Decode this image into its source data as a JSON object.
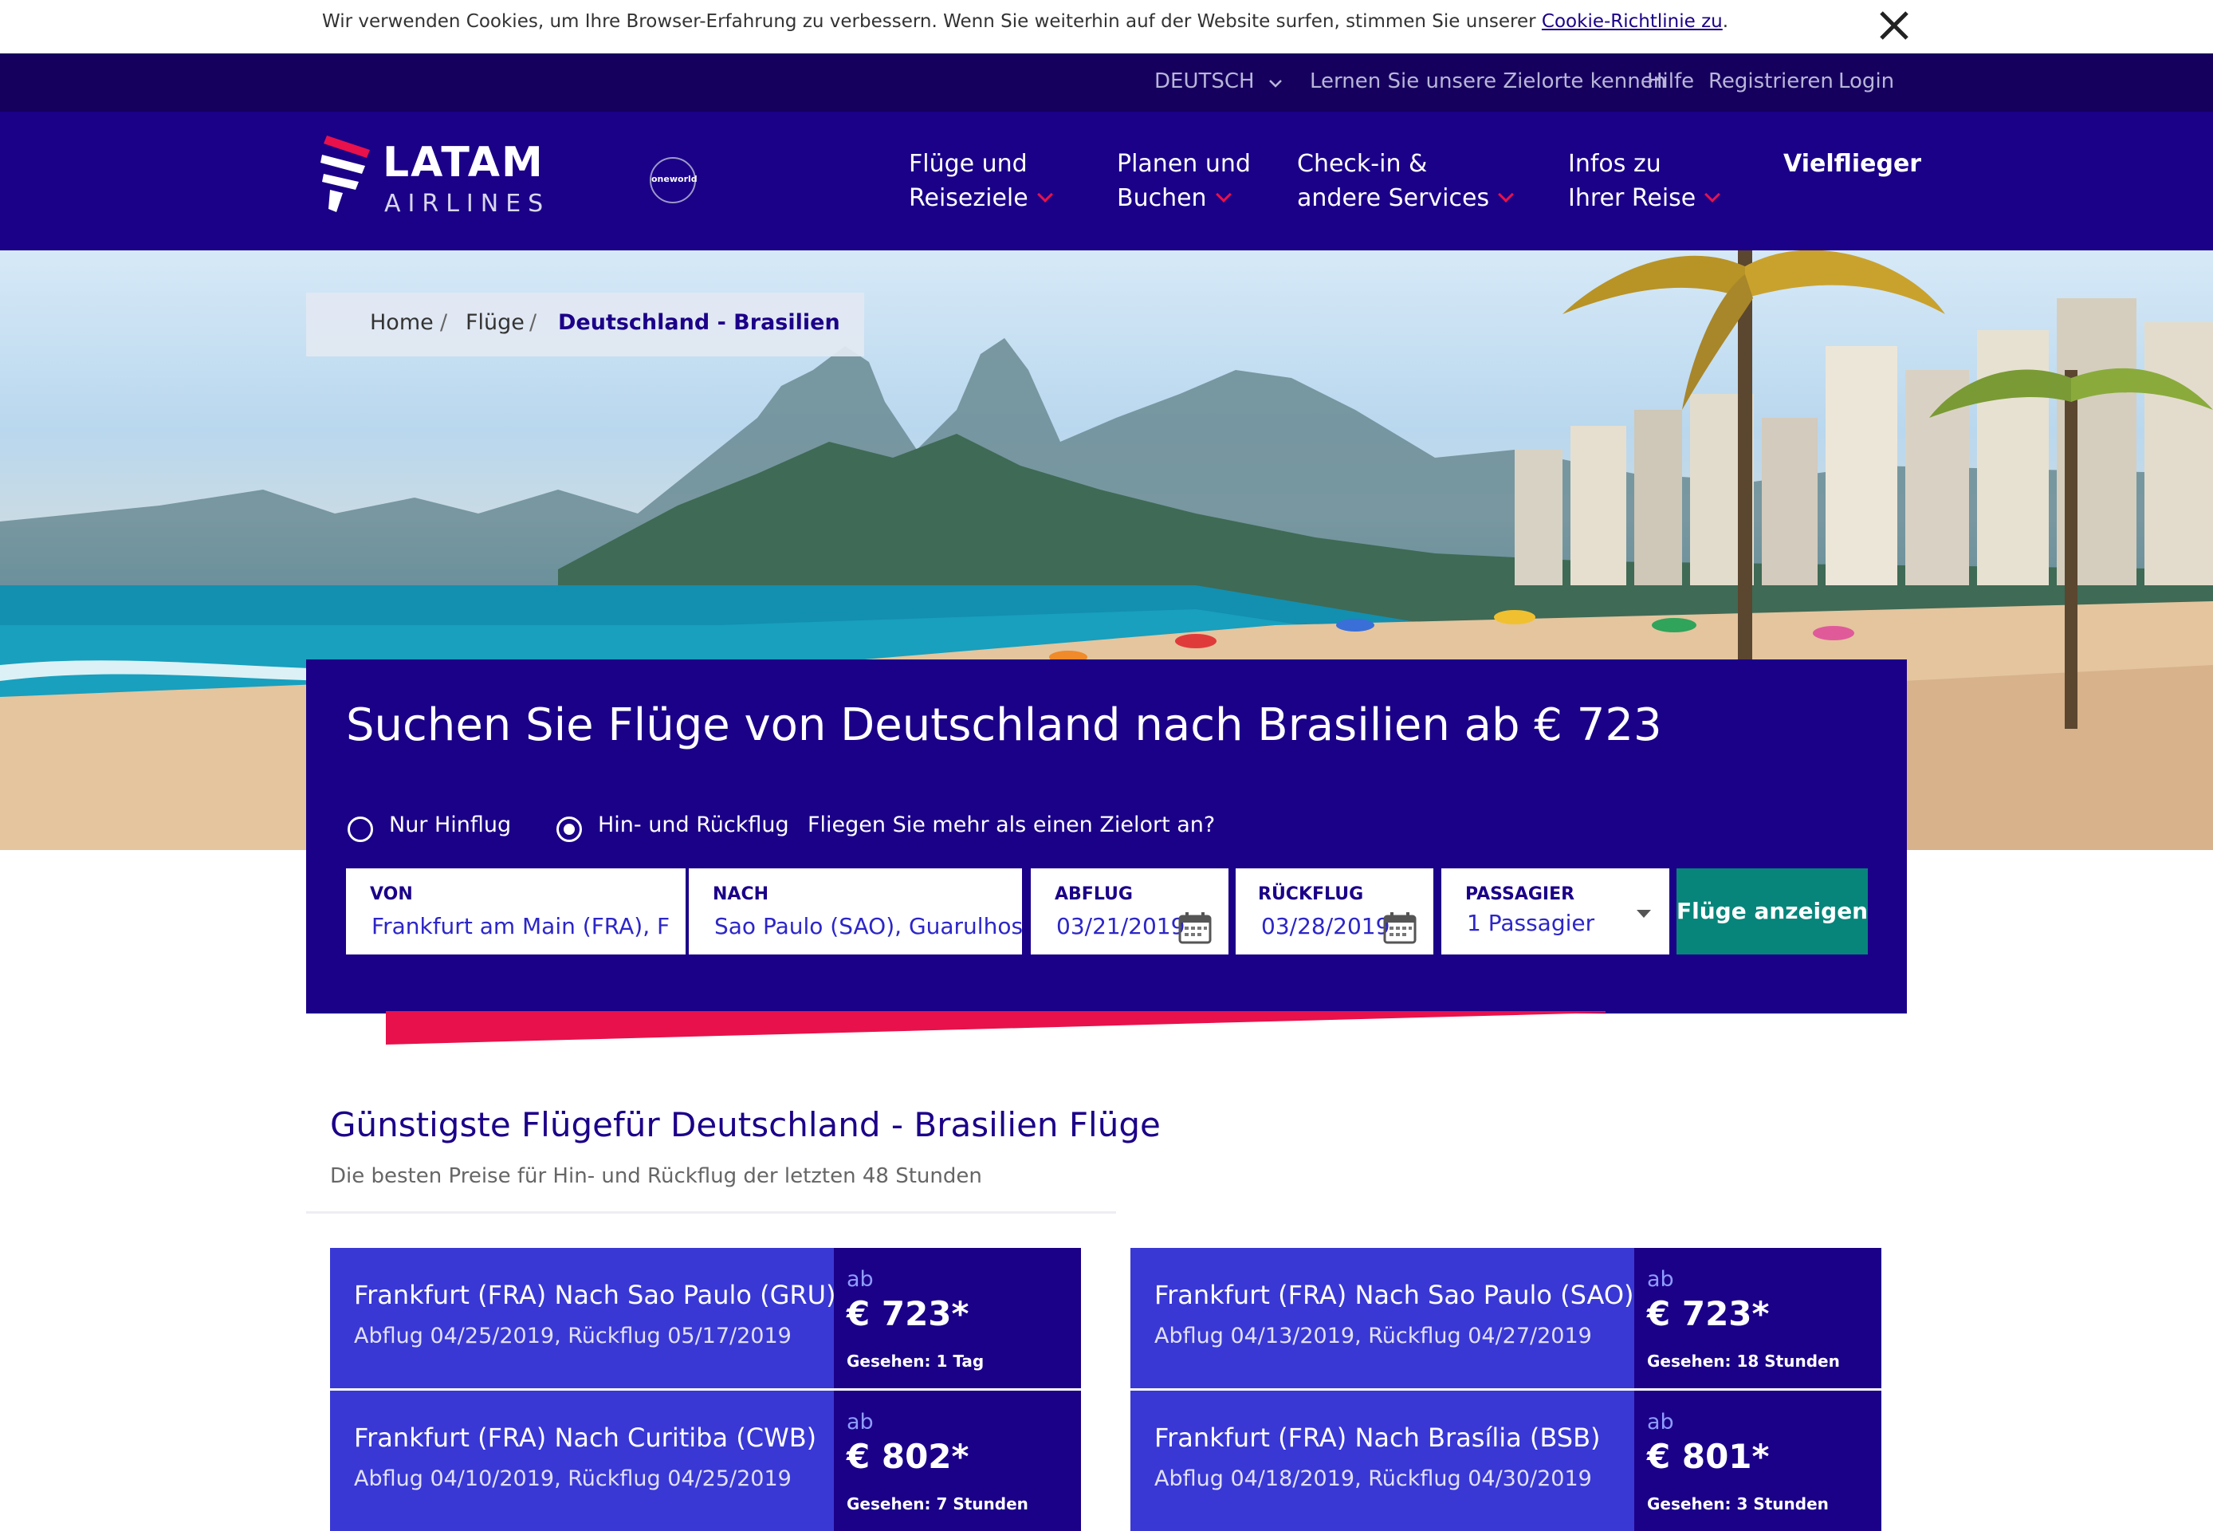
{
  "cookie": {
    "text": "Wir verwenden Cookies, um Ihre Browser-Erfahrung zu verbessern. Wenn Sie weiterhin auf der Website surfen, stimmen Sie unserer ",
    "link": "Cookie-Richtlinie zu",
    "suffix": "."
  },
  "topbar": {
    "language": "DEUTSCH",
    "destinations": "Lernen Sie unsere Zielorte kennen",
    "help": "Hilfe",
    "register": "Registrieren",
    "login": "Login"
  },
  "logo": {
    "line1": "LATAM",
    "line2": "AIRLINES",
    "partner": "oneworld"
  },
  "nav": [
    {
      "l1": "Flüge und",
      "l2": "Reiseziele"
    },
    {
      "l1": "Planen und",
      "l2": "Buchen"
    },
    {
      "l1": "Check-in &",
      "l2": "andere Services"
    },
    {
      "l1": "Infos zu",
      "l2": "Ihrer Reise"
    },
    {
      "l1": "Vielflieger"
    }
  ],
  "breadcrumb": {
    "home": "Home",
    "sep": "/",
    "flights": "Flüge",
    "current": "Deutschland - Brasilien"
  },
  "search": {
    "title": "Suchen Sie Flüge von Deutschland nach Brasilien ab € 723",
    "one_way": "Nur Hinflug",
    "round_trip": "Hin- und Rückflug",
    "multi": "Fliegen Sie mehr als einen Zielort an?",
    "from_label": "VON",
    "from_value": "Frankfurt am Main (FRA), F",
    "to_label": "NACH",
    "to_value": "Sao Paulo (SAO), Guarulhos",
    "depart_label": "ABFLUG",
    "depart_value": "03/21/2019",
    "return_label": "RÜCKFLUG",
    "return_value": "03/28/2019",
    "pax_label": "PASSAGIER",
    "pax_value": "1 Passagier",
    "submit": "Flüge anzeigen"
  },
  "cheapest": {
    "title": "Günstigste Flügefür Deutschland - Brasilien Flüge",
    "subtitle": "Die besten Preise für Hin- und Rückflug der letzten 48 Stunden",
    "cards": [
      {
        "route": "Frankfurt (FRA) Nach Sao Paulo (GRU)",
        "dates": "Abflug 04/25/2019, Rückflug 05/17/2019",
        "ab": "ab",
        "price": "€ 723*",
        "seen": "Gesehen: 1 Tag"
      },
      {
        "route": "Frankfurt (FRA) Nach Sao Paulo (SAO)",
        "dates": "Abflug 04/13/2019, Rückflug 04/27/2019",
        "ab": "ab",
        "price": "€ 723*",
        "seen": "Gesehen: 18 Stunden"
      },
      {
        "route": "Frankfurt (FRA) Nach Curitiba (CWB)",
        "dates": "Abflug 04/10/2019, Rückflug 04/25/2019",
        "ab": "ab",
        "price": "€ 802*",
        "seen": "Gesehen: 7 Stunden"
      },
      {
        "route": "Frankfurt (FRA) Nach Brasília (BSB)",
        "dates": "Abflug 04/18/2019, Rückflug 04/30/2019",
        "ab": "ab",
        "price": "€ 801*",
        "seen": "Gesehen: 3 Stunden"
      }
    ]
  },
  "colors": {
    "brand": "#1b0088",
    "accent": "#e8114b",
    "cta": "#07857b",
    "card": "#3938d4"
  }
}
